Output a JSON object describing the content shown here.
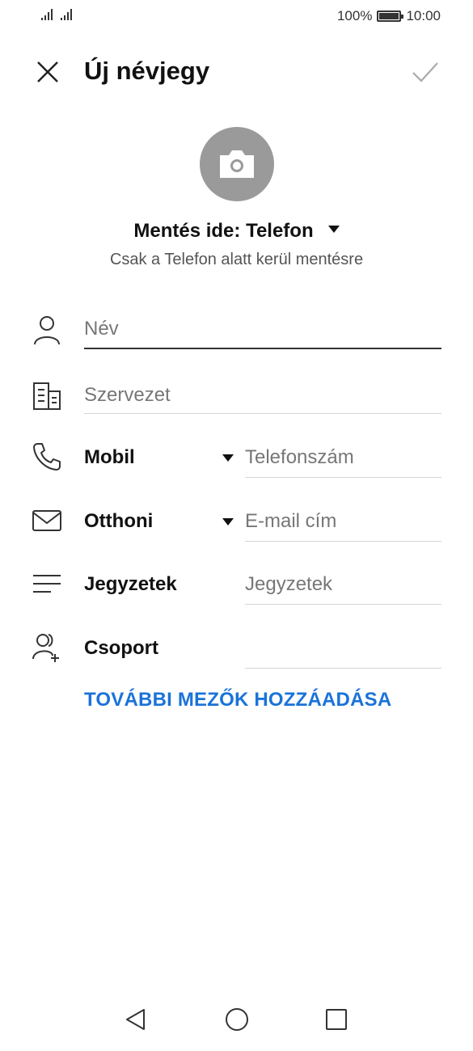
{
  "status_bar": {
    "battery": "100%",
    "battery_level": 1.0,
    "time": "10:00"
  },
  "header": {
    "title": "Új névjegy"
  },
  "account": {
    "save_to": "Mentés ide: Telefon",
    "subtitle": "Csak a Telefon alatt kerül mentésre"
  },
  "fields": {
    "name_placeholder": "Név",
    "org_placeholder": "Szervezet",
    "phone_label": "Mobil",
    "phone_placeholder": "Telefonszám",
    "email_label": "Otthoni",
    "email_placeholder": "E-mail cím",
    "notes_label": "Jegyzetek",
    "notes_placeholder": "Jegyzetek",
    "group_label": "Csoport"
  },
  "more_fields": "TOVÁBBI MEZŐK HOZZÁADÁSA",
  "colors": {
    "accent": "#1a73d9",
    "avatar_bg": "#9a9a9a"
  },
  "icons": [
    "signal-icon",
    "battery-icon",
    "close-icon",
    "check-icon",
    "camera-icon",
    "person-icon",
    "organization-icon",
    "phone-icon",
    "email-icon",
    "notes-icon",
    "group-add-icon",
    "back-nav-icon",
    "home-nav-icon",
    "recents-nav-icon"
  ]
}
